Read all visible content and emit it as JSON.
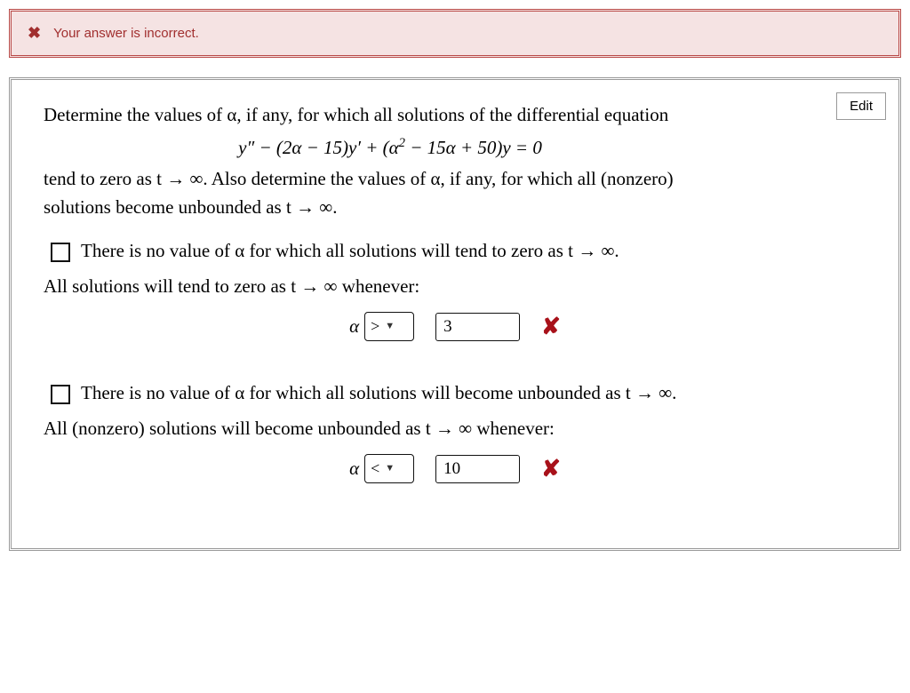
{
  "alert": {
    "icon": "✖",
    "text": "Your answer is incorrect."
  },
  "edit_label": "Edit",
  "prompt": {
    "line1": "Determine the values of α, if any, for which all solutions of the differential equation",
    "line2_posttend": "tend to zero as t → ∞. Also determine the values of α, if any, for which all (nonzero) solutions become unbounded as t → ∞."
  },
  "equation": {
    "y": "y″ − (2α − 15)y′ + (α",
    "sup": "2",
    "tail": " − 15α + 50)y = 0"
  },
  "part1": {
    "checkbox_label": "There is no value of α for which all solutions will tend to zero as t → ∞.",
    "statement": "All solutions will tend to zero as t → ∞ whenever:",
    "alpha": "α",
    "relation": ">",
    "value": "3",
    "mark": "✘"
  },
  "part2": {
    "checkbox_label": "There is no value of α for which all solutions will become unbounded as t → ∞.",
    "statement": "All (nonzero) solutions will become unbounded as t → ∞ whenever:",
    "alpha": "α",
    "relation": "<",
    "value": "10",
    "mark": "✘"
  }
}
